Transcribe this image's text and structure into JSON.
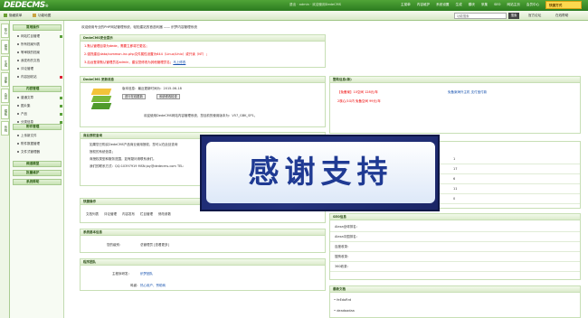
{
  "header": {
    "logo": "DEDECMS",
    "logo_suffix": "®",
    "info": "退出 · admin · 欢迎使用DedeCMS",
    "nav": [
      "主菜单",
      "内容维护",
      "系统设置",
      "生成",
      "模块",
      "采集",
      "SEO",
      "网站主页",
      "会员中心"
    ],
    "quick": "快捷方式"
  },
  "toolbar": {
    "item1": "隐藏菜单",
    "item2": "功能地图",
    "search_placeholder": "功能搜索",
    "search_button": "搜索",
    "official": "官方论坛",
    "online": "在线帮助"
  },
  "tabs": [
    "核心",
    "模块",
    "生成",
    "采集",
    "会员",
    "模板",
    "系统"
  ],
  "menu": {
    "section1": "常用操作",
    "section1_items": [
      "网站栏目管理",
      "所有档案列表",
      "等审核的档案",
      "我发布的文档",
      "评论管理",
      "内容回收站"
    ],
    "section2": "内容管理",
    "section2_items": [
      "普通文章",
      "图片集",
      "产品",
      "分类信息"
    ],
    "section3": "附件管理",
    "section3_items": [
      "上传新文件",
      "附件数据管理",
      "文件式管理器"
    ],
    "section4": "频道模型",
    "section5": "批量维护",
    "section6": "系统帮助"
  },
  "welcome": {
    "text": "欢迎使用专业的PHP网站管理系统，轻松建站的首选利器 —— 织梦内容管理系统",
    "link": ""
  },
  "security": {
    "title": "DedeCMS安全提示",
    "lines": [
      "1.默认管理目录为dede，需要立即将它更名；",
      "2.强烈建议data/common.inc.php文件属性设置为644（Linux/Unix）或只读（NT）；",
      "3.后台登录默认管理员名admin，建议您修改为其他管理员名；"
    ],
    "line3_link": "马上修改"
  },
  "update": {
    "title": "DedeCMS 更新消息",
    "version": "版本信息：最近更新时间为：2015-06-18",
    "btn_check": "进行在线更新",
    "btn_env": "系统修改检查",
    "note": "欢迎使用DedeCMS网站内容管理系统，您目前的使用版本为：V57_GBK_SP1。"
  },
  "business": {
    "title": "商业授权查询",
    "lines": [
      "如果您已购买DedeCMS产品商业使用授权，您可以在此处查询",
      "授权的系统信息；",
      "商授权类型和服务范围，如有疑问请联系我们。",
      "我们的联系方式：QQ:10397919 MSN:joy@dedecms.com TEL:"
    ]
  },
  "quickops": {
    "title": "快捷操作",
    "items": [
      "文档列表",
      "评论管理",
      "内容发布",
      "栏目管理",
      "修改参数"
    ]
  },
  "sysinfo": {
    "title": "系统基本信息",
    "label": "您的级别：",
    "value": "总管理员 [查看更多]"
  },
  "team": {
    "title": "程序团队",
    "lead_label": "主程序研发：",
    "lead_value": "织梦团队",
    "thanks_label": "鸣谢：",
    "thanks_value": "热心用户、赞助商"
  },
  "help": {
    "title": "整助信息(新)",
    "line1a": "【免备案】10空间 128元/年",
    "line1b": "免备案海外主机 支付宝付款",
    "line2": "2核心/1G内 免备空间 99元/年"
  },
  "stats": {
    "values": [
      "1",
      "17",
      "6",
      "11",
      "0"
    ]
  },
  "seo": {
    "title": "SEO信息",
    "rows": [
      "Alexa全球排名：",
      "Alexa中国排名：",
      "百度收录：",
      "搜狗收录：",
      "360收录："
    ]
  },
  "docs": {
    "title": "最新文档",
    "items": [
      "feEdoRrd",
      "deadaadaa"
    ]
  },
  "overlay": {
    "text": "感谢支持"
  }
}
